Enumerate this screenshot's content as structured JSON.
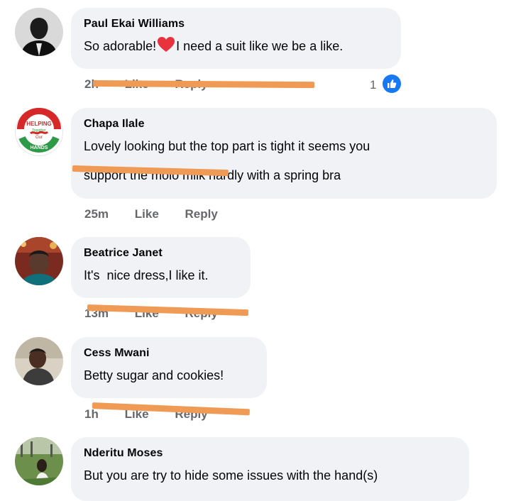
{
  "comments": [
    {
      "author": "Paul Ekai Williams",
      "text_before_heart": "So adorable!",
      "text_after_heart": "I need a suit like we be a like.",
      "time": "2h",
      "like": "Like",
      "reply": "Reply",
      "reaction_count": "1"
    },
    {
      "author": "Chapa Ilale",
      "text_line1": "Lovely looking but the top part is tight it seems you",
      "text_line2": "support the molo milk hardly with a spring bra",
      "time": "25m",
      "like": "Like",
      "reply": "Reply",
      "avatar_lines": [
        "HELPING",
        "Together",
        "Our",
        "HANDS"
      ]
    },
    {
      "author": "Beatrice Janet",
      "text": "It's  nice dress,I like it.",
      "time": "13m",
      "like": "Like",
      "reply": "Reply"
    },
    {
      "author": "Cess Mwani",
      "text": "Betty sugar and cookies!",
      "time": "1h",
      "like": "Like",
      "reply": "Reply"
    },
    {
      "author": "Nderitu Moses",
      "text": "But you are try to hide some issues with the hand(s)"
    }
  ],
  "colors": {
    "bubble": "#f0f2f5",
    "meta": "#65676b",
    "like_badge": "#1877f2",
    "heart": "#e8323e",
    "redaction_stroke": "#ef9a55"
  },
  "icons": {
    "heart": "heart-emoji-icon",
    "like_badge": "thumbs-up-icon"
  }
}
